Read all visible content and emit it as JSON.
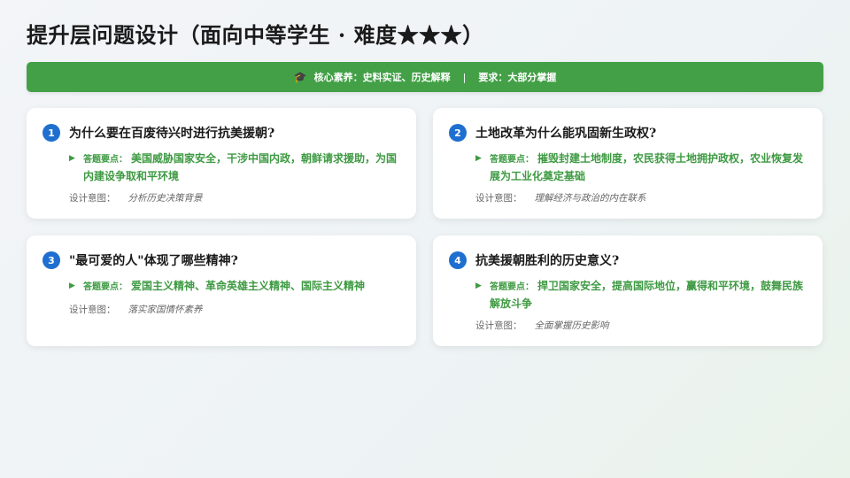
{
  "title": "提升层问题设计（面向中等学生 · 难度★★★）",
  "banner": {
    "icon": "graduation-cap-icon",
    "icon_glyph": "🎓",
    "core_literacy": "核心素养：史料实证、历史解释",
    "separator": "|",
    "requirement": "要求：大部分掌握"
  },
  "colors": {
    "banner_green": "#43a047",
    "answer_green": "#3e9a42",
    "number_blue": "#1e6fd0"
  },
  "answer_label": "答题要点：",
  "intent_label": "设计意图：",
  "questions": [
    {
      "number": "1",
      "question": "为什么要在百废待兴时进行抗美援朝?",
      "answer": "美国威胁国家安全，干涉中国内政，朝鲜请求援助，为国内建设争取和平环境",
      "intent": "分析历史决策背景"
    },
    {
      "number": "2",
      "question": "土地改革为什么能巩固新生政权?",
      "answer": "摧毁封建土地制度，农民获得土地拥护政权，农业恢复发展为工业化奠定基础",
      "intent": "理解经济与政治的内在联系"
    },
    {
      "number": "3",
      "question": "\"最可爱的人\"体现了哪些精神?",
      "answer": "爱国主义精神、革命英雄主义精神、国际主义精神",
      "intent": "落实家国情怀素养"
    },
    {
      "number": "4",
      "question": "抗美援朝胜利的历史意义?",
      "answer": "捍卫国家安全，提高国际地位，赢得和平环境，鼓舞民族解放斗争",
      "intent": "全面掌握历史影响"
    }
  ]
}
